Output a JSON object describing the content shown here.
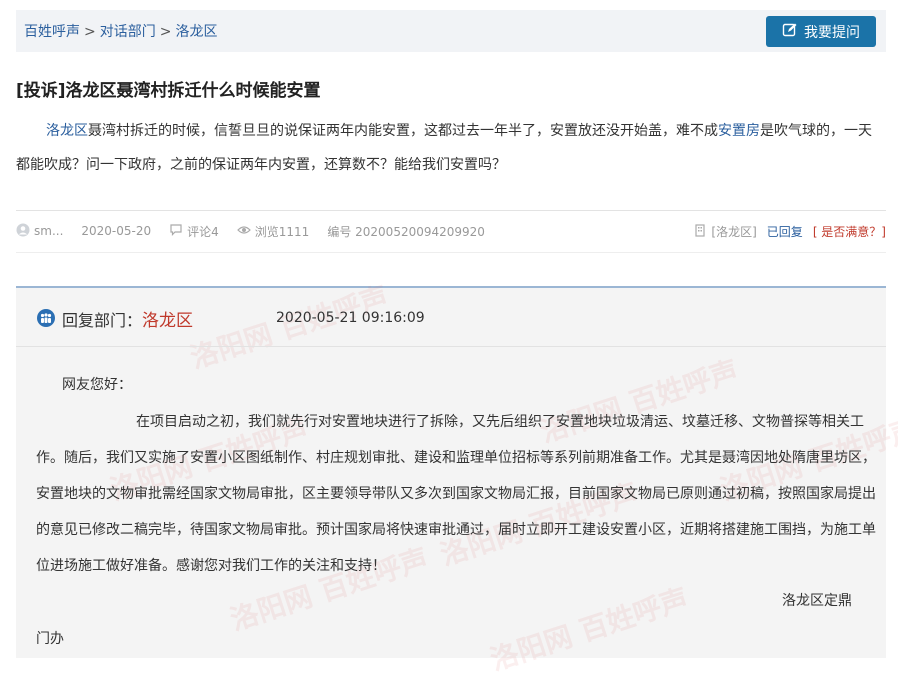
{
  "breadcrumb": {
    "items": [
      "百姓呼声",
      "对话部门",
      "洛龙区"
    ],
    "separator": ">"
  },
  "ask_button": {
    "label": "我要提问",
    "icon": "edit-icon"
  },
  "post": {
    "title": "[投诉]洛龙区聂湾村拆迁什么时候能安置",
    "content": {
      "link1": "洛龙区",
      "text1": "聂湾村拆迁的时候，信誓旦旦的说保证两年内能安置，这都过去一年半了，安置放还没开始盖，难不成",
      "link2": "安置房",
      "text2": "是吹气球的，一天都能吹成？问一下政府，之前的保证两年内安置，还算数不？能给我们安置吗？"
    },
    "meta": {
      "user": "sm...",
      "date": "2020-05-20",
      "comments": "评论4",
      "views": "浏览1111",
      "number": "编号 20200520094209920",
      "area": "[洛龙区]",
      "status": "已回复",
      "satisfied": "[ 是否满意？]"
    }
  },
  "reply": {
    "label": "回复部门：",
    "dept": "洛龙区",
    "time": "2020-05-21 09:16:09",
    "greeting": "网友您好：",
    "body": "在项目启动之初，我们就先行对安置地块进行了拆除，又先后组织了安置地块垃圾清运、坟墓迁移、文物普探等相关工作。随后，我们又实施了安置小区图纸制作、村庄规划审批、建设和监理单位招标等系列前期准备工作。尤其是聂湾因地处隋唐里坊区，安置地块的文物审批需经国家文物局审批，区主要领导带队又多次到国家文物局汇报，目前国家文物局已原则通过初稿，按照国家局提出的意见已修改二稿完毕，待国家文物局审批。预计国家局将快速审批通过，届时立即开工建设安置小区，近期将搭建施工围挡，为施工单位进场施工做好准备。感谢您对我们工作的关注和支持！",
    "signature": "洛龙区定鼎",
    "signature_tail": "门办"
  },
  "watermark": {
    "text": "洛阳网 百姓呼声"
  },
  "colors": {
    "link": "#2b5f9e",
    "button": "#1b73a8",
    "accent_red": "#c0392b"
  }
}
